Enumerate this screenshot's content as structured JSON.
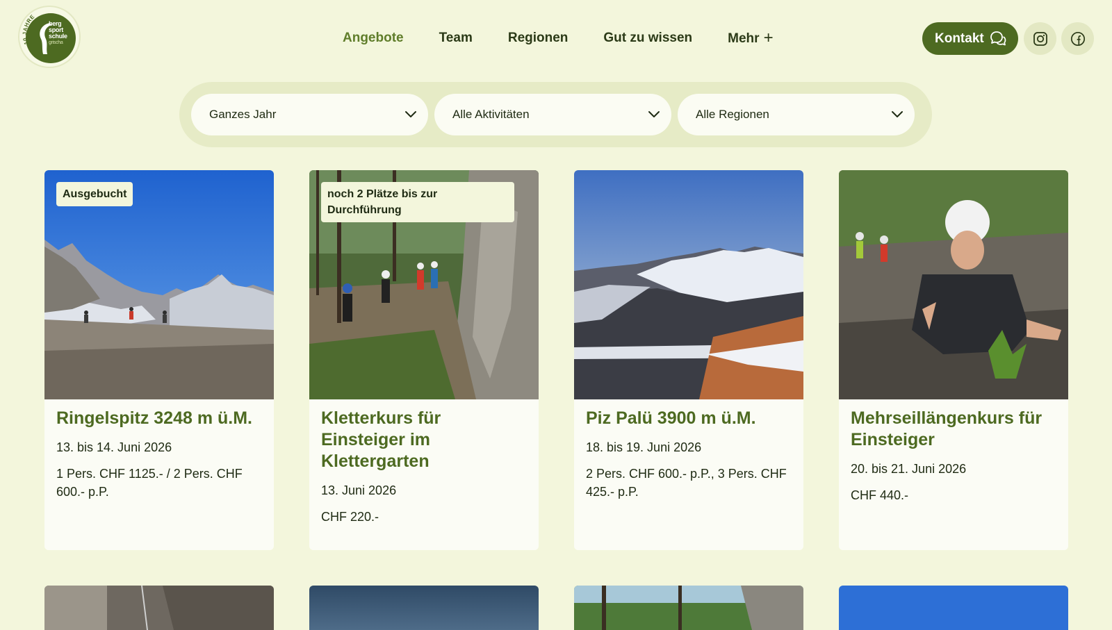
{
  "logo": {
    "ring_text": "10 JAHRE",
    "lines": [
      "berg",
      "sport",
      "schule",
      "grischa"
    ]
  },
  "nav": [
    {
      "label": "Angebote",
      "active": true
    },
    {
      "label": "Team",
      "active": false
    },
    {
      "label": "Regionen",
      "active": false
    },
    {
      "label": "Gut zu wissen",
      "active": false
    },
    {
      "label": "Mehr",
      "active": false,
      "icon": "plus-icon"
    }
  ],
  "contact": {
    "label": "Kontakt",
    "icon": "chat-bubble-icon"
  },
  "social": [
    {
      "icon": "instagram-icon"
    },
    {
      "icon": "facebook-icon"
    }
  ],
  "filters": [
    {
      "value": "Ganzes Jahr",
      "icon": "chevron-down-icon"
    },
    {
      "value": "Alle Aktivitäten",
      "icon": "chevron-down-icon"
    },
    {
      "value": "Alle Regionen",
      "icon": "chevron-down-icon"
    }
  ],
  "cards": [
    {
      "badge": "Ausgebucht",
      "title": "Ringelspitz 3248 m ü.M.",
      "date": "13. bis 14. Juni 2026",
      "price": "1 Pers. CHF 1125.- / 2 Pers. CHF 600.- p.P."
    },
    {
      "badge": "noch 2 Plätze bis zur Durchführung",
      "title": "Kletterkurs für Einsteiger im Klettergarten",
      "date": "13. Juni 2026",
      "price": "CHF 220.-"
    },
    {
      "badge": "",
      "title": "Piz Palü 3900 m ü.M.",
      "date": "18. bis 19. Juni 2026",
      "price": "2 Pers. CHF 600.- p.P., 3 Pers. CHF 425.- p.P."
    },
    {
      "badge": "",
      "title": "Mehrseillängenkurs für Einsteiger",
      "date": "20. bis 21. Juni 2026",
      "price": "CHF 440.-"
    }
  ],
  "colors": {
    "background": "#f3f6dc",
    "accent": "#4d6a21",
    "card": "#fbfcf5"
  }
}
